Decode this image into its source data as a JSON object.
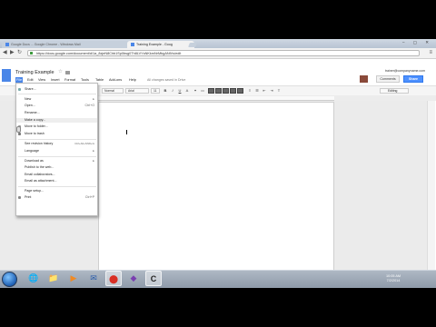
{
  "browser": {
    "tabs": [
      {
        "label": "Google Docs ... Google Chrome - Windows Mail"
      },
      {
        "label": "Training Example - Goog",
        "close": "×"
      }
    ],
    "window_controls": "– ▢ ✕",
    "nav": {
      "back": "◀",
      "forward": "▶",
      "reload": "↻"
    },
    "url": "https://docs.google.com/document/d/1a_8xjeN8Chb1Sp0bsg0Th8LVYsNKkmNrMbgANtVs/edit",
    "menu_glyph": "≡"
  },
  "doc": {
    "title": "Training Example",
    "star": "☆",
    "save_status": "All changes saved in Drive",
    "user": "trainer@companyname.com",
    "comments_label": "Comments",
    "share_label": "Share",
    "menu": [
      "File",
      "Edit",
      "View",
      "Insert",
      "Format",
      "Tools",
      "Table",
      "Add-ons",
      "Help"
    ]
  },
  "toolbar": {
    "style_select": "Normal",
    "font_select": "Arial",
    "size_select": "11",
    "bold": "B",
    "italic": "I",
    "underline": "U",
    "color": "A",
    "editing_label": "Editing"
  },
  "file_menu": {
    "items": [
      {
        "label": "Share...",
        "shortcut": ""
      },
      {
        "label": "New",
        "shortcut": "▸"
      },
      {
        "label": "Open...",
        "shortcut": "Ctrl+O"
      },
      {
        "label": "Rename...",
        "shortcut": ""
      },
      {
        "label": "Make a copy...",
        "shortcut": ""
      },
      {
        "label": "Move to folder...",
        "shortcut": ""
      },
      {
        "label": "Move to trash",
        "shortcut": ""
      },
      {
        "label": "See revision history",
        "shortcut": "Ctrl+Alt+Shift+G"
      },
      {
        "label": "Language",
        "shortcut": "▸"
      },
      {
        "label": "Download as",
        "shortcut": "▸"
      },
      {
        "label": "Publish to the web...",
        "shortcut": ""
      },
      {
        "label": "Email collaborators...",
        "shortcut": ""
      },
      {
        "label": "Email as attachment...",
        "shortcut": ""
      },
      {
        "label": "Page setup...",
        "shortcut": ""
      },
      {
        "label": "Print",
        "shortcut": "Ctrl+P"
      }
    ]
  },
  "taskbar": {
    "clock_time": "10:05 AM",
    "clock_date": "7/2/2014",
    "icons": [
      "🌐",
      "📁",
      "▶",
      "✉",
      "⬤",
      "◆",
      "C"
    ]
  },
  "colors": {
    "accent": "#4a86e8",
    "share": "#4d90fe"
  }
}
